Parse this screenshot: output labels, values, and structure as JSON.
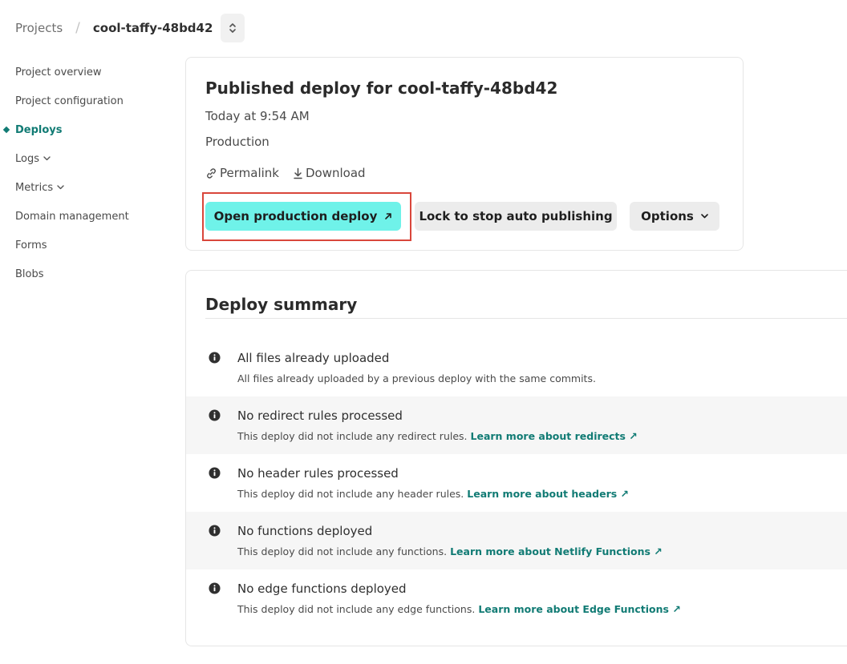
{
  "breadcrumb": {
    "projects": "Projects",
    "separator": "/",
    "current": "cool-taffy-48bd42"
  },
  "sidebar": {
    "items": [
      {
        "label": "Project overview"
      },
      {
        "label": "Project configuration"
      },
      {
        "label": "Deploys"
      },
      {
        "label": "Logs"
      },
      {
        "label": "Metrics"
      },
      {
        "label": "Domain management"
      },
      {
        "label": "Forms"
      },
      {
        "label": "Blobs"
      }
    ]
  },
  "deploy": {
    "title": "Published deploy for cool-taffy-48bd42",
    "time": "Today at 9:54 AM",
    "environment": "Production",
    "permalink": "Permalink",
    "download": "Download",
    "open_button": "Open production deploy",
    "lock_button": "Lock to stop auto publishing",
    "options_button": "Options"
  },
  "summary": {
    "title": "Deploy summary",
    "rows": [
      {
        "title": "All files already uploaded",
        "desc": "All files already uploaded by a previous deploy with the same commits.",
        "link": ""
      },
      {
        "title": "No redirect rules processed",
        "desc": "This deploy did not include any redirect rules.",
        "link": "Learn more about redirects ↗"
      },
      {
        "title": "No header rules processed",
        "desc": "This deploy did not include any header rules.",
        "link": "Learn more about headers ↗"
      },
      {
        "title": "No functions deployed",
        "desc": "This deploy did not include any functions.",
        "link": "Learn more about Netlify Functions ↗"
      },
      {
        "title": "No edge functions deployed",
        "desc": "This deploy did not include any edge functions.",
        "link": "Learn more about Edge Functions ↗"
      }
    ]
  },
  "colors": {
    "accent": "#117b74",
    "primary_button": "#6ff2e9",
    "highlight": "#d9463b"
  }
}
